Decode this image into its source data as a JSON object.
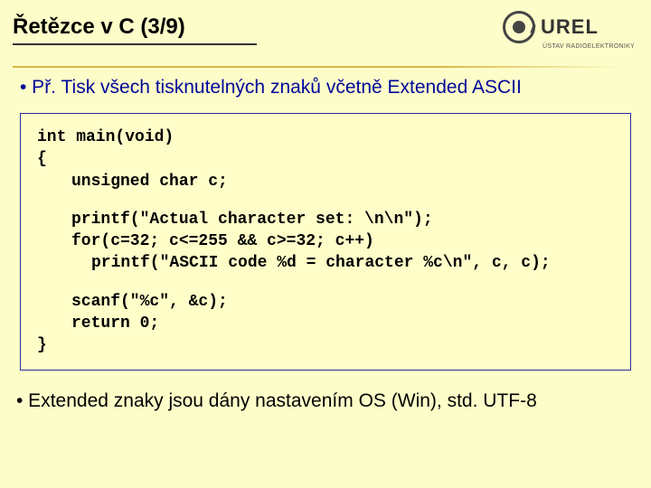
{
  "title": "Řetězce v C (3/9)",
  "logo": {
    "text": "UREL",
    "sub": "ÚSTAV RADIOELEKTRONIKY"
  },
  "bullet1": "• Př. Tisk všech tisknutelných znaků včetně Extended ASCII",
  "code": {
    "l1": "int main(void)",
    "l2": "{",
    "l3": "unsigned char c;",
    "l4": "printf(\"Actual character set: \\n\\n\");",
    "l5": "for(c=32; c<=255 && c>=32; c++)",
    "l6": "printf(\"ASCII code %d = character %c\\n\", c, c);",
    "l7": "scanf(\"%c\", &c);",
    "l8": "return 0;",
    "l9": "}"
  },
  "note": "• Extended znaky jsou dány nastavením OS (Win), std. UTF-8"
}
